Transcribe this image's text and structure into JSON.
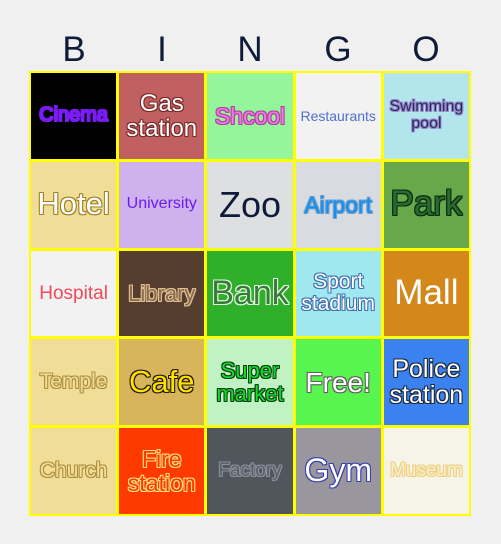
{
  "header": [
    "B",
    "I",
    "N",
    "G",
    "O"
  ],
  "cells": [
    {
      "label": "Cinema",
      "bg": "#000000",
      "color": "#7a1cf5",
      "outline": "#7a1cf5"
    },
    {
      "label": "Gas station",
      "bg": "#c06060",
      "color": "#ffffff",
      "outline": "#7a2a2a"
    },
    {
      "label": "Shcool",
      "bg": "#94f59a",
      "color": "#f07ae0",
      "outline": "#b040a0"
    },
    {
      "label": "Restaurants",
      "bg": "#f2f2f2",
      "color": "#5070d0",
      "outline": "none"
    },
    {
      "label": "Swimming pool",
      "bg": "#b3e5ec",
      "color": "#2a2a5a",
      "outline": "#9a8ad0"
    },
    {
      "label": "Hotel",
      "bg": "#f0de98",
      "color": "#ffffff",
      "outline": "#a08020"
    },
    {
      "label": "University",
      "bg": "#cfb1ee",
      "color": "#6a1cf0",
      "outline": "none"
    },
    {
      "label": "Zoo",
      "bg": "#dedfe0",
      "color": "#0f1b3a",
      "outline": "none"
    },
    {
      "label": "Airport",
      "bg": "#d8dce0",
      "color": "#1a8ee8",
      "outline": "#6aa0d0"
    },
    {
      "label": "Park",
      "bg": "#66a84a",
      "color": "#2a6a30",
      "outline": "#0a2a10"
    },
    {
      "label": "Hospital",
      "bg": "#f2f2f2",
      "color": "#f04a5a",
      "outline": "none"
    },
    {
      "label": "Library",
      "bg": "#553d30",
      "color": "#8a6a50",
      "outline": "#e0c090"
    },
    {
      "label": "Bank",
      "bg": "#30b02a",
      "color": "#3a7a3a",
      "outline": "#e0ffe0"
    },
    {
      "label": "Sport stadium",
      "bg": "#9fe8f0",
      "color": "#ffffff",
      "outline": "#4070b0"
    },
    {
      "label": "Mall",
      "bg": "#d4881c",
      "color": "#ffffff",
      "outline": "none"
    },
    {
      "label": "Temple",
      "bg": "#f0de98",
      "color": "#f0de98",
      "outline": "#b09040"
    },
    {
      "label": "Cafe",
      "bg": "#d8b45a",
      "color": "#ffe000",
      "outline": "#201a00"
    },
    {
      "label": "Super market",
      "bg": "#c0f2c4",
      "color": "#18d830",
      "outline": "#0a4010"
    },
    {
      "label": "Free!",
      "bg": "#58f54e",
      "color": "#ffffff",
      "outline": "#606060"
    },
    {
      "label": "Police station",
      "bg": "#3b82f0",
      "color": "#ffffff",
      "outline": "#1a2a40"
    },
    {
      "label": "Church",
      "bg": "#f0de98",
      "color": "#f0de98",
      "outline": "#b09040"
    },
    {
      "label": "Fire station",
      "bg": "#ff3a00",
      "color": "#ff3a00",
      "outline": "#ffe080"
    },
    {
      "label": "Factory",
      "bg": "#51565c",
      "color": "#5a606a",
      "outline": "#8a8f9a"
    },
    {
      "label": "Gym",
      "bg": "#9a969e",
      "color": "#ffffff",
      "outline": "#3a40b0"
    },
    {
      "label": "Museum",
      "bg": "#f6f4e6",
      "color": "#f6f0d0",
      "outline": "#f0d080"
    }
  ]
}
